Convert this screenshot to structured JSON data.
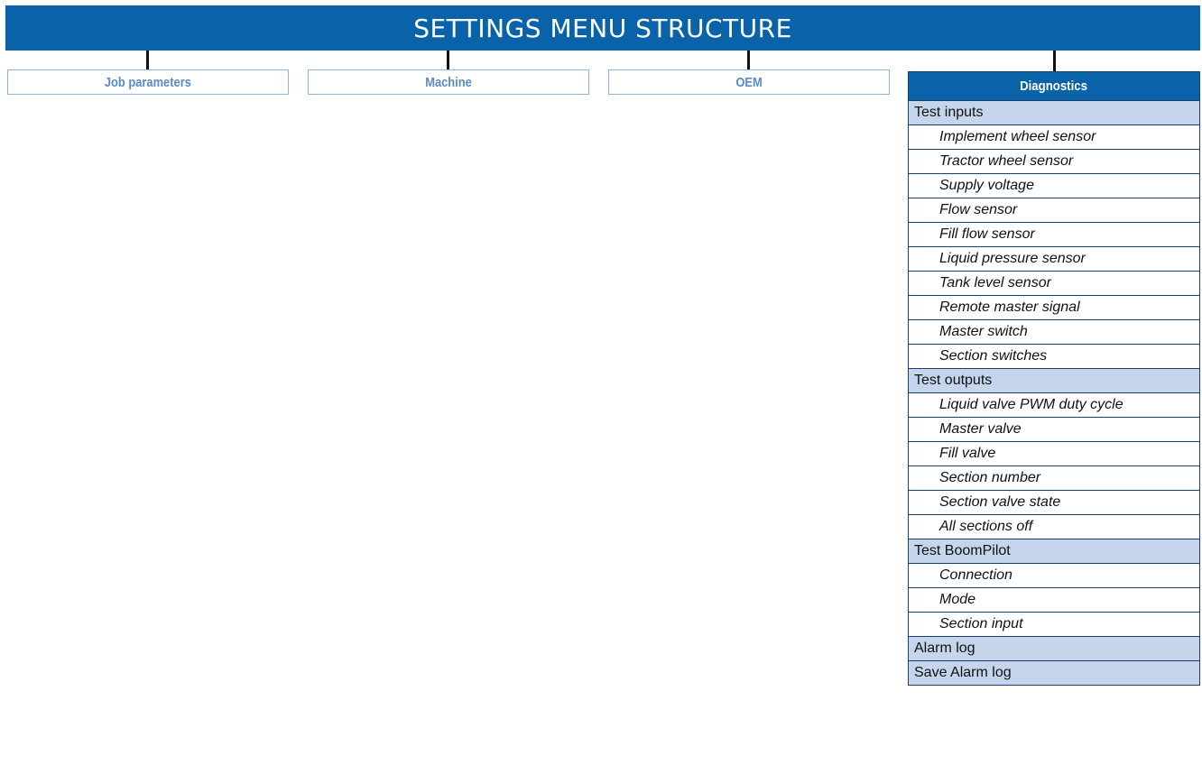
{
  "title": "SETTINGS MENU STRUCTURE",
  "top_menus": [
    {
      "label": "Job parameters"
    },
    {
      "label": "Machine"
    },
    {
      "label": "OEM"
    }
  ],
  "diagnostics": {
    "header": "Diagnostics",
    "rows": [
      {
        "label": "Test inputs",
        "kind": "group"
      },
      {
        "label": "Implement wheel sensor",
        "kind": "item"
      },
      {
        "label": "Tractor wheel sensor",
        "kind": "item"
      },
      {
        "label": "Supply voltage",
        "kind": "item"
      },
      {
        "label": "Flow sensor",
        "kind": "item"
      },
      {
        "label": "Fill flow sensor",
        "kind": "item"
      },
      {
        "label": "Liquid pressure sensor",
        "kind": "item"
      },
      {
        "label": "Tank level sensor",
        "kind": "item"
      },
      {
        "label": "Remote master signal",
        "kind": "item"
      },
      {
        "label": "Master switch",
        "kind": "item"
      },
      {
        "label": "Section switches",
        "kind": "item"
      },
      {
        "label": "Test outputs",
        "kind": "group"
      },
      {
        "label": "Liquid valve PWM duty cycle",
        "kind": "item"
      },
      {
        "label": "Master valve",
        "kind": "item"
      },
      {
        "label": "Fill valve",
        "kind": "item"
      },
      {
        "label": "Section number",
        "kind": "item"
      },
      {
        "label": "Section valve state",
        "kind": "item"
      },
      {
        "label": "All sections off",
        "kind": "item"
      },
      {
        "label": "Test BoomPilot",
        "kind": "group"
      },
      {
        "label": "Connection",
        "kind": "item"
      },
      {
        "label": "Mode",
        "kind": "item"
      },
      {
        "label": "Section input",
        "kind": "item"
      },
      {
        "label": "Alarm log",
        "kind": "group"
      },
      {
        "label": "Save Alarm log",
        "kind": "group"
      }
    ]
  },
  "colors": {
    "header_blue": "#0a63a8",
    "group_fill": "#c4d5ec",
    "box_border": "#8fb3d9",
    "box_text": "#5b8bc3"
  }
}
